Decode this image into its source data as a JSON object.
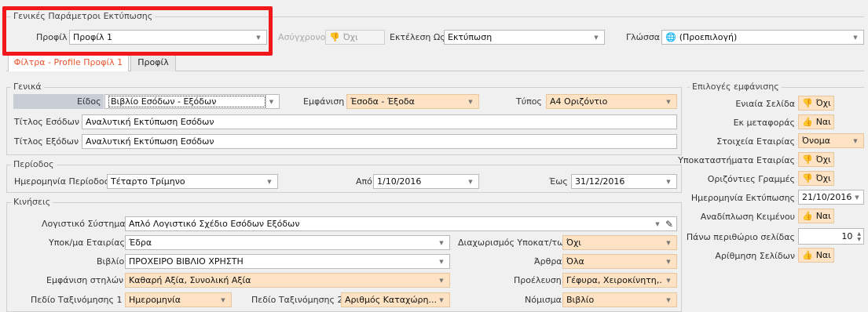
{
  "general": {
    "group_title": "Γενικές Παράμετροι Εκτύπωσης",
    "profile_label": "Προφίλ",
    "profile_value": "Προφίλ 1",
    "async_label": "Ασύγχρονο",
    "async_value": "Όχι",
    "exec_label": "Εκτέλεση Ως",
    "exec_value": "Εκτύπωση",
    "lang_label": "Γλώσσα",
    "lang_value": "(Προεπιλογή)"
  },
  "tabs": [
    {
      "label": "Φίλτρα - Profile Προφίλ 1"
    },
    {
      "label": "Προφίλ"
    }
  ],
  "generic": {
    "title": "Γενικά",
    "kind_label": "Είδος",
    "kind_value": "Βιβλίο Εσόδων - Εξόδων",
    "view_label": "Εμφάνιση",
    "view_value": "Έσοδα - Έξοδα",
    "type_label": "Τύπος",
    "type_value": "A4 Οριζόντιο",
    "income_title_label": "Τίτλος Εσόδων",
    "income_title_value": "Αναλυτική Εκτύπωση Εσόδων",
    "expense_title_label": "Τίτλος Εξόδων",
    "expense_title_value": "Αναλυτική Εκτύπωση Εσόδων"
  },
  "period": {
    "title": "Περίοδος",
    "date_period_label": "Ημερομηνία Περίοδος",
    "date_period_value": "Τέταρτο Τρίμηνο",
    "from_label": "Από",
    "from_value": "1/10/2016",
    "to_label": "Έως",
    "to_value": "31/12/2016"
  },
  "moves": {
    "title": "Κινήσεις",
    "acc_system_label": "Λογιστικό Σύστημα",
    "acc_system_value": "Απλό Λογιστικό Σχέδιο Εσόδων Εξόδων",
    "branch_label": "Υποκ/μα Εταιρίας",
    "branch_value": "Έδρα",
    "split_label": "Διαχωρισμός Υποκατ/των",
    "split_value": "Όχι",
    "book_label": "Βιβλίο",
    "book_value": "ΠΡΟΧΕΙΡΟ ΒΙΒΛΙΟ ΧΡΗΣΤΗ",
    "articles_label": "Άρθρα",
    "articles_value": "Όλα",
    "columns_label": "Εμφάνιση στηλών",
    "columns_value": "Καθαρή Αξία, Συνολική Αξία",
    "origin_label": "Προέλευση",
    "origin_value": "Γέφυρα, Χειροκίνητη,...",
    "sort1_label": "Πεδίο Ταξινόμησης 1",
    "sort1_value": "Ημερομηνία",
    "sort2_label": "Πεδίο Ταξινόμησης 2",
    "sort2_value": "Αριθμός Καταχώρη...",
    "currency_label": "Νόμισμα",
    "currency_value": "Βιβλίο"
  },
  "display": {
    "title": "Επιλογές εμφάνισης",
    "single_page_label": "Ενιαία Σελίδα",
    "single_page_value": "Όχι",
    "carry_label": "Εκ μεταφοράς",
    "carry_value": "Ναι",
    "company_label": "Στοιχεία Εταιρίας",
    "company_value": "Όνομα",
    "branches_label": "Υποκαταστήματα Εταιρίας",
    "branches_value": "Όχι",
    "hlines_label": "Οριζόντιες Γραμμές",
    "hlines_value": "Όχι",
    "print_date_label": "Ημερομηνία Εκτύπωσης",
    "print_date_value": "21/10/2016",
    "wrap_label": "Αναδίπλωση Κειμένου",
    "wrap_value": "Ναι",
    "top_margin_label": "Πάνω περιθώριο σελίδας",
    "top_margin_value": "10",
    "page_num_label": "Αρίθμηση Σελίδων",
    "page_num_value": "Ναι"
  },
  "colors": {
    "highlight": "#f2171b",
    "peach": "#fde3c3",
    "tab_active": "#e8542c"
  }
}
